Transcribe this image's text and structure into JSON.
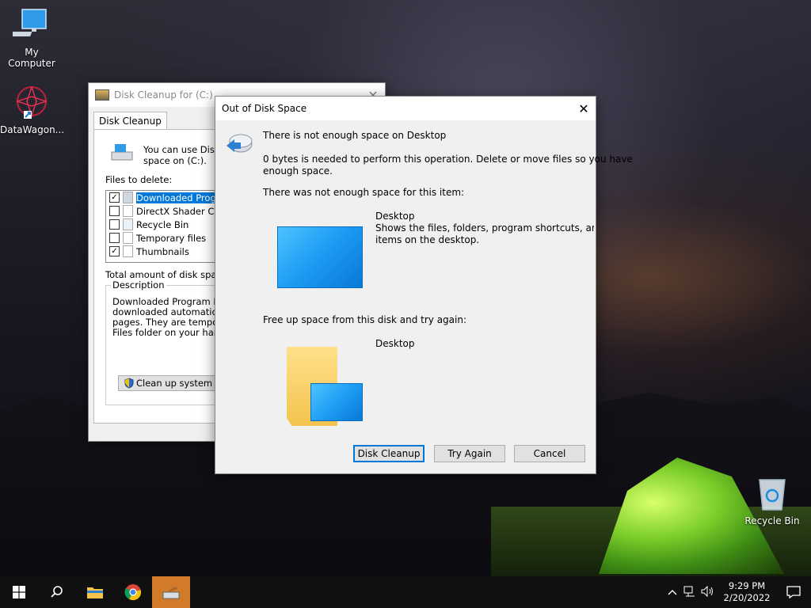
{
  "desktop": {
    "icons": [
      {
        "label": "My Computer"
      },
      {
        "label": "DataWagon..."
      },
      {
        "label": "Recycle Bin"
      }
    ]
  },
  "cleanup_window": {
    "title": "Disk Cleanup for  (C:)",
    "tab": "Disk Cleanup",
    "intro_line1": "You can use Disk Cl",
    "intro_line2": "space on  (C:).",
    "files_label": "Files to delete:",
    "files": [
      {
        "label": "Downloaded Program",
        "checked": true
      },
      {
        "label": "DirectX Shader Cach",
        "checked": false
      },
      {
        "label": "Recycle Bin",
        "checked": false
      },
      {
        "label": "Temporary files",
        "checked": false
      },
      {
        "label": "Thumbnails",
        "checked": true
      }
    ],
    "total_label": "Total amount of disk space yo",
    "description_title": "Description",
    "description_lines": [
      "Downloaded Program Files",
      "downloaded automatically fr",
      "pages. They are temporarily",
      "Files folder on your hard disk"
    ],
    "system_files_button": "Clean up system files"
  },
  "dialog": {
    "title": "Out of Disk Space",
    "heading": "There is not enough space on Desktop",
    "message_line1": "0 bytes is needed to perform this operation. Delete or move files so you have",
    "message_line2": "enough space.",
    "item_label": "There was not enough space for this item:",
    "item_name": "Desktop",
    "item_desc_line1": "Shows the files, folders, program shortcuts, and othe",
    "item_desc_line2": "items on the desktop.",
    "freeup_label": "Free up space from this disk and try again:",
    "disk_name": "Desktop",
    "buttons": {
      "cleanup": "Disk Cleanup",
      "retry": "Try Again",
      "cancel": "Cancel"
    }
  },
  "taskbar": {
    "time": "9:29 PM",
    "date": "2/20/2022"
  }
}
